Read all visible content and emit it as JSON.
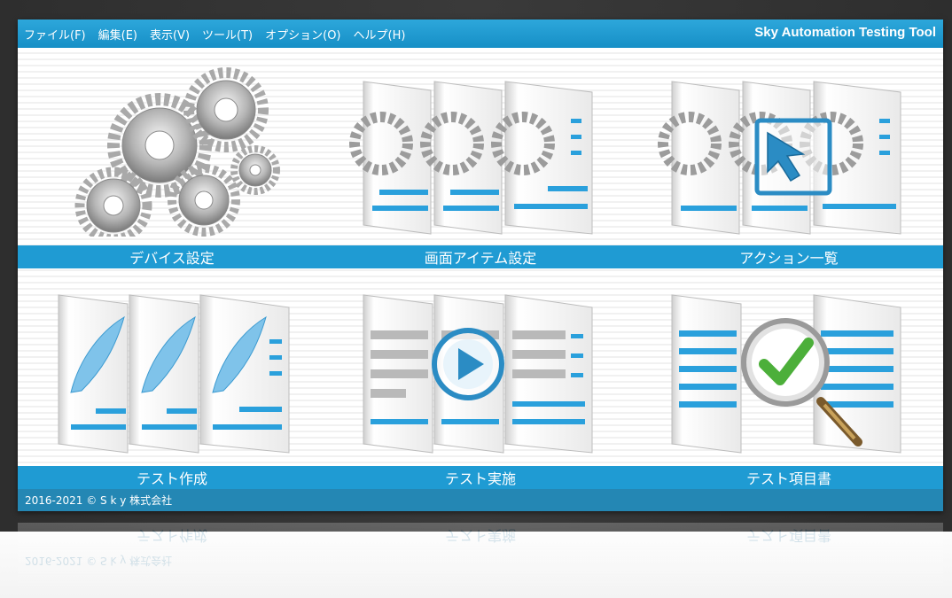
{
  "menubar": {
    "items": [
      {
        "label": "ファイル(F)"
      },
      {
        "label": "編集(E)"
      },
      {
        "label": "表示(V)"
      },
      {
        "label": "ツール(T)"
      },
      {
        "label": "オプション(O)"
      },
      {
        "label": "ヘルプ(H)"
      }
    ],
    "app_title": "Sky Automation Testing Tool"
  },
  "tiles": [
    {
      "label": "デバイス設定",
      "icon": "gears-icon"
    },
    {
      "label": "画面アイテム設定",
      "icon": "screen-items-icon"
    },
    {
      "label": "アクション一覧",
      "icon": "action-list-icon"
    },
    {
      "label": "テスト作成",
      "icon": "feather-pages-icon"
    },
    {
      "label": "テスト実施",
      "icon": "play-pages-icon"
    },
    {
      "label": "テスト項目書",
      "icon": "magnifier-check-icon"
    }
  ],
  "footer": {
    "copyright": "2016-2021 © S k y 株式会社"
  },
  "colors": {
    "menubar": "#168fc6",
    "label_bar": "#1f9bd3",
    "footer": "#2487b4",
    "accent_blue": "#2aa0dc",
    "check_green": "#4caf3a"
  }
}
